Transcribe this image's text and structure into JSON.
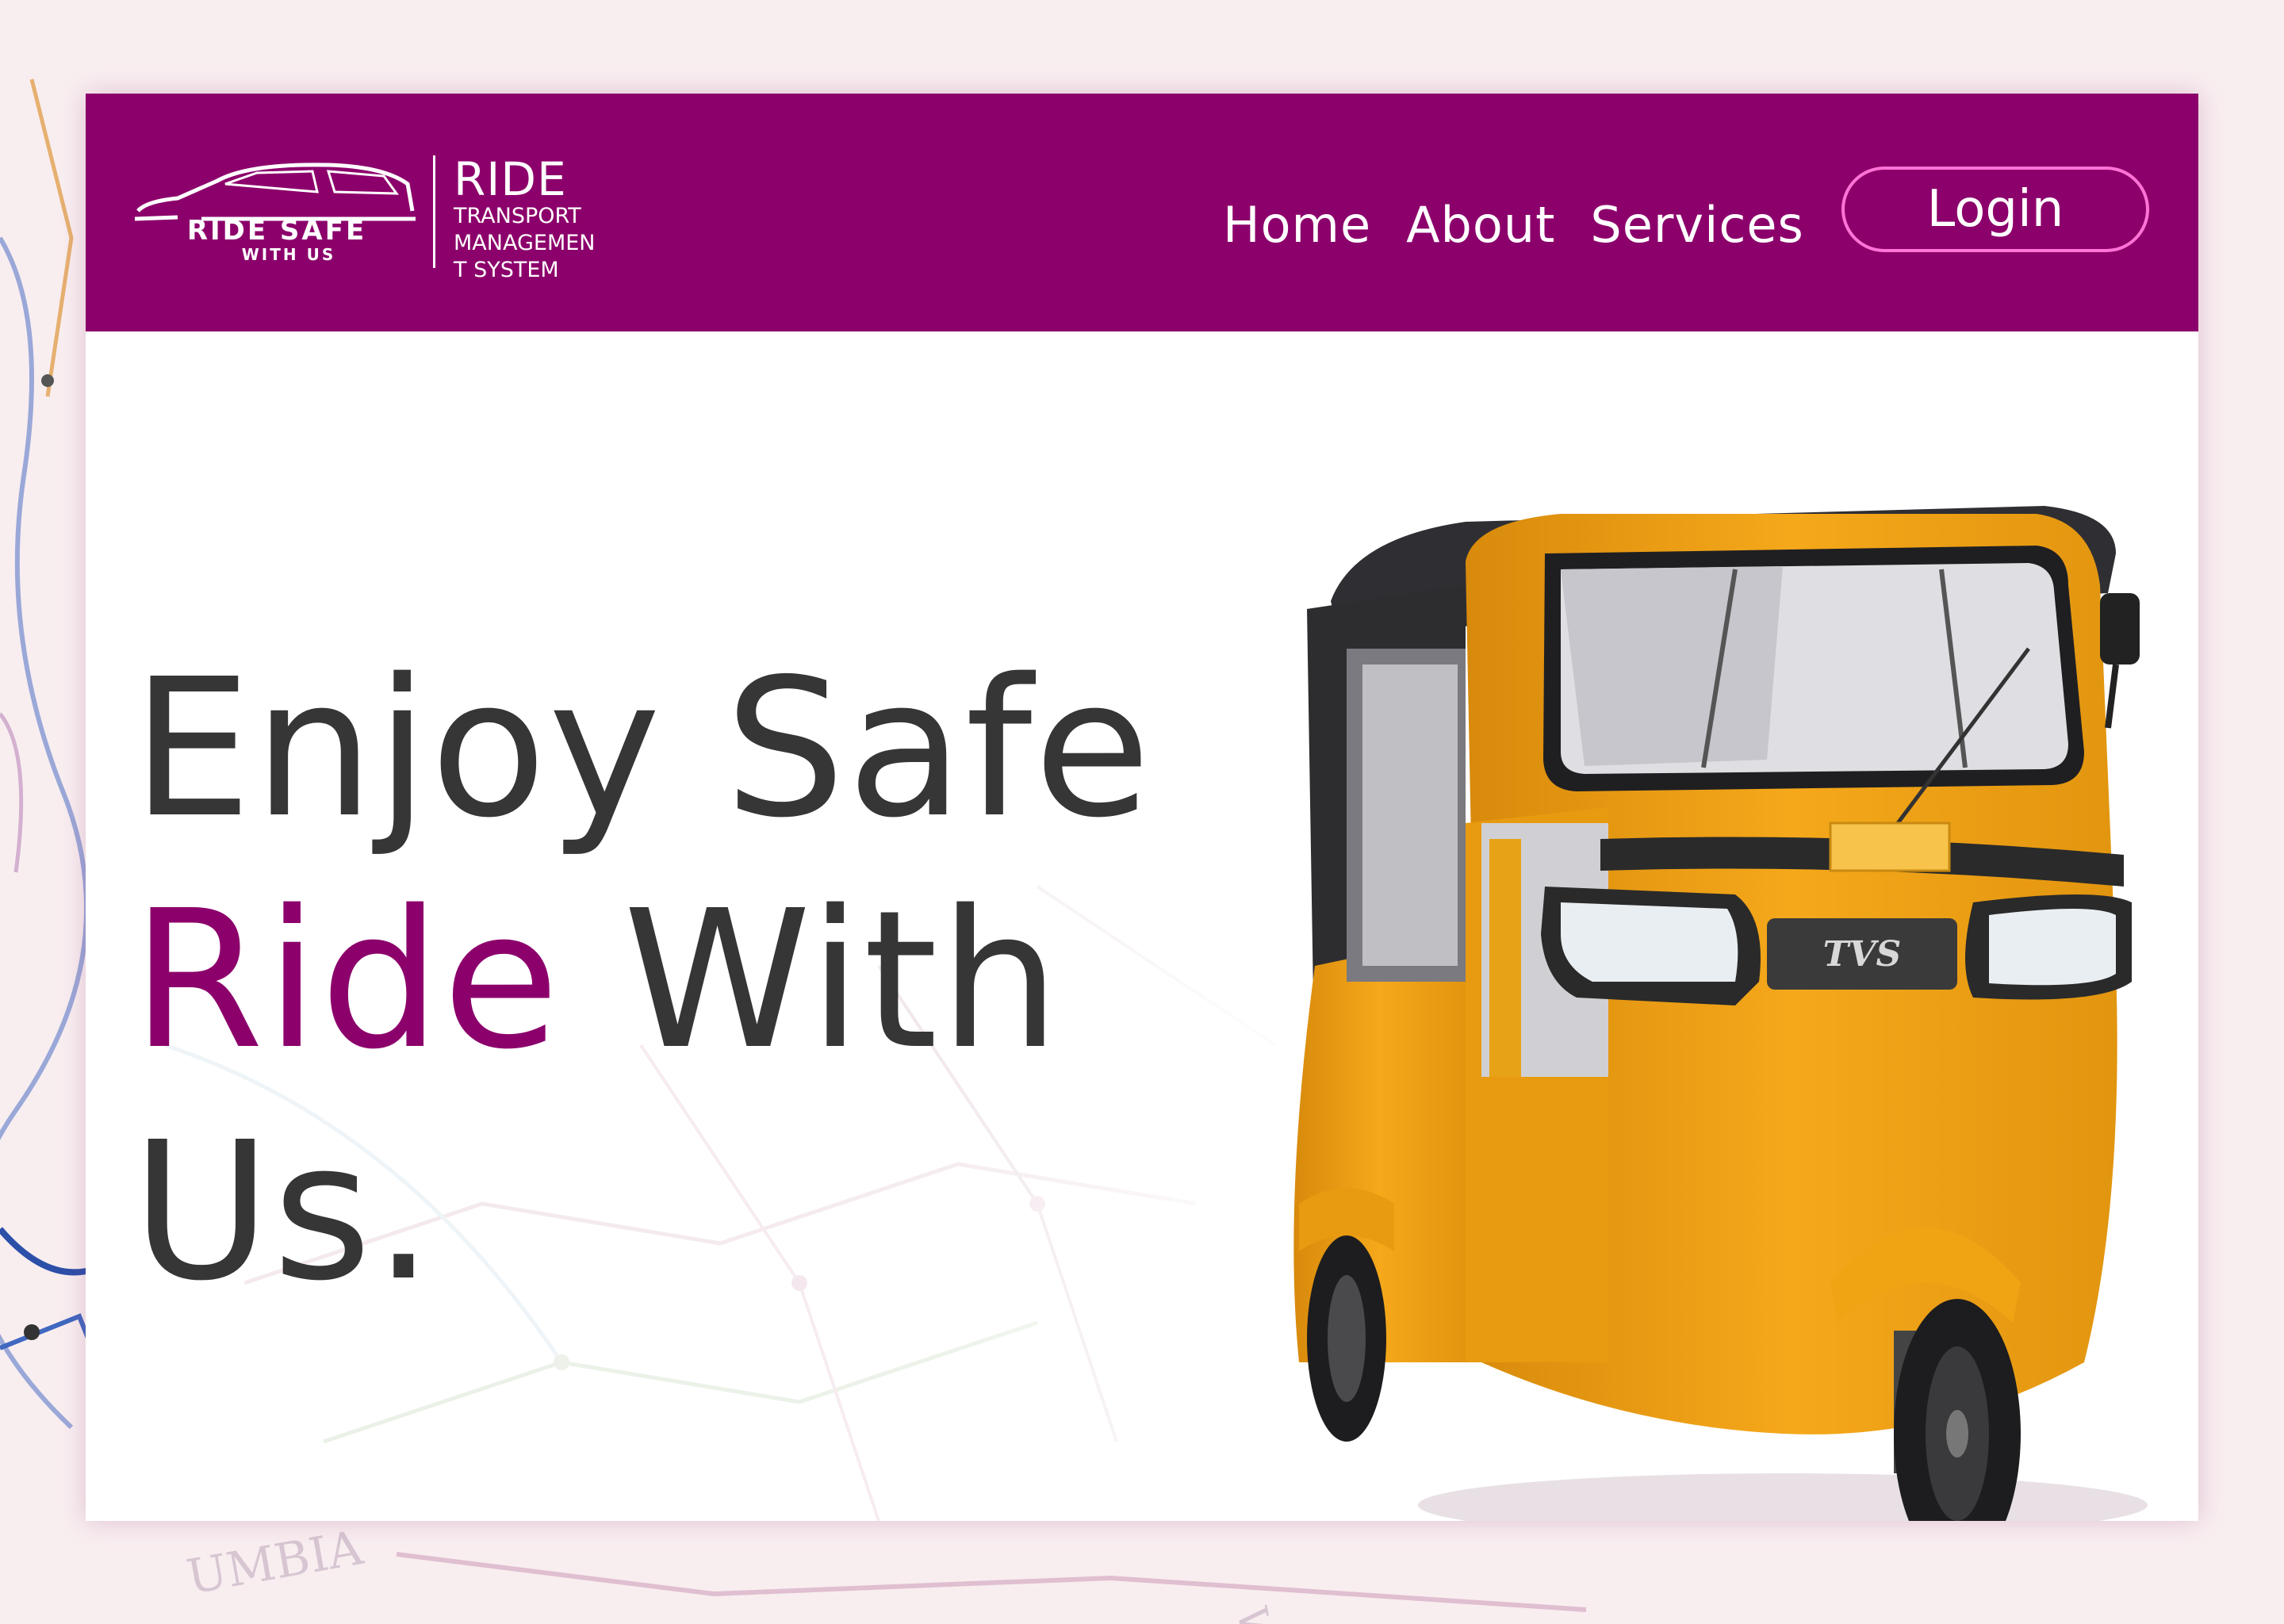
{
  "brand": {
    "logo_main": "RIDE SAFE",
    "logo_sub": "WITH US",
    "title": "RIDE",
    "subtitle": "TRANSPORT MANAGEMENT SYSTEM"
  },
  "nav": {
    "links": [
      "Home",
      "About",
      "Services"
    ],
    "login_label": "Login"
  },
  "hero": {
    "line1": "Enjoy Safe",
    "accent": "Ride",
    "line2_rest": " With",
    "line3": "Us."
  },
  "vehicle": {
    "badge": "TVS"
  },
  "colors": {
    "brand": "#8c006b",
    "login_border": "#ff74d6",
    "vehicle_body": "#f2a216",
    "text": "#363636"
  }
}
